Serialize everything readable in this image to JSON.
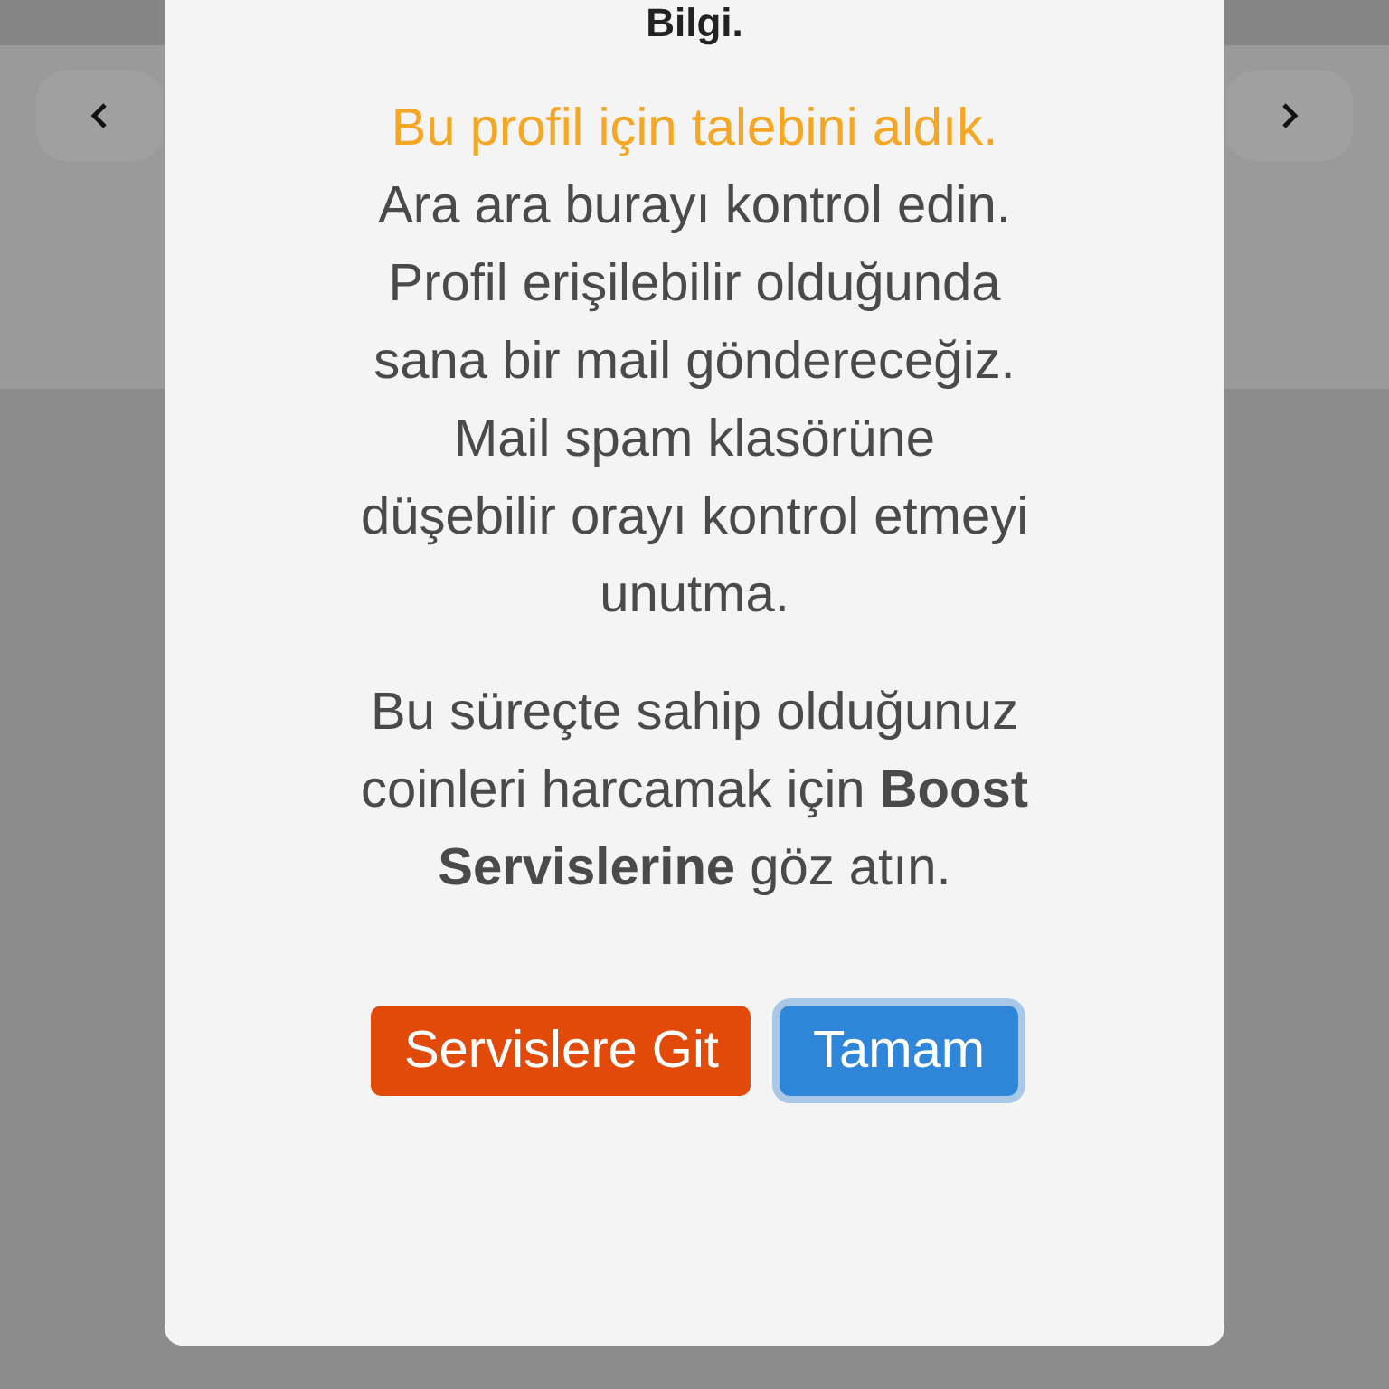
{
  "dialog": {
    "title": "Bilgi.",
    "highlight": "Bu profil için talebini aldık.",
    "paragraphs": [
      "Ara ara burayı kontrol edin. Profil erişilebilir olduğunda sana bir mail göndereceğiz.",
      "Mail spam klasörüne düşebilir orayı kontrol etmeyi unutma."
    ],
    "note": "Bu süreçte sahip olduğunuz coinleri harcamak için **Boost Servislerine** göz atın.",
    "buttons": [
      {
        "label": "Servislere Git",
        "kind": "secondary",
        "focused": false
      },
      {
        "label": "Tamam",
        "kind": "primary",
        "focused": true
      }
    ]
  }
}
